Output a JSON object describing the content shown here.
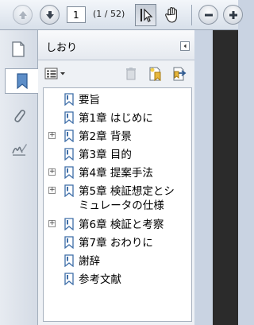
{
  "toolbar": {
    "page_value": "1",
    "page_count": "(1 / 52)"
  },
  "panel": {
    "title": "しおり"
  },
  "bookmarks": [
    {
      "label": "要旨",
      "expandable": false
    },
    {
      "label": "第1章 はじめに",
      "expandable": false
    },
    {
      "label": "第2章 背景",
      "expandable": true
    },
    {
      "label": "第3章 目的",
      "expandable": false
    },
    {
      "label": "第4章 提案手法",
      "expandable": true
    },
    {
      "label": "第5章 検証想定とシ",
      "label2": "ミュレータの仕様",
      "expandable": true
    },
    {
      "label": "第6章 検証と考察",
      "expandable": true
    },
    {
      "label": "第7章 おわりに",
      "expandable": false
    },
    {
      "label": "謝辞",
      "expandable": false
    },
    {
      "label": "参考文献",
      "expandable": false
    }
  ],
  "colors": {
    "toolbar_bg": "#e3e8ef",
    "strip_bg": "#dde3eb",
    "bookmark_icon": "#3e6ea8",
    "document_page": "#2b2b2b"
  },
  "icons": [
    "up-arrow-icon",
    "down-arrow-icon",
    "select-cursor-icon",
    "hand-icon",
    "zoom-out-icon",
    "zoom-in-icon",
    "pages-icon",
    "bookmark-icon",
    "attachment-icon",
    "signature-icon",
    "options-icon",
    "delete-icon",
    "new-bookmark-icon",
    "expand-bookmark-icon",
    "collapse-panel-icon"
  ]
}
